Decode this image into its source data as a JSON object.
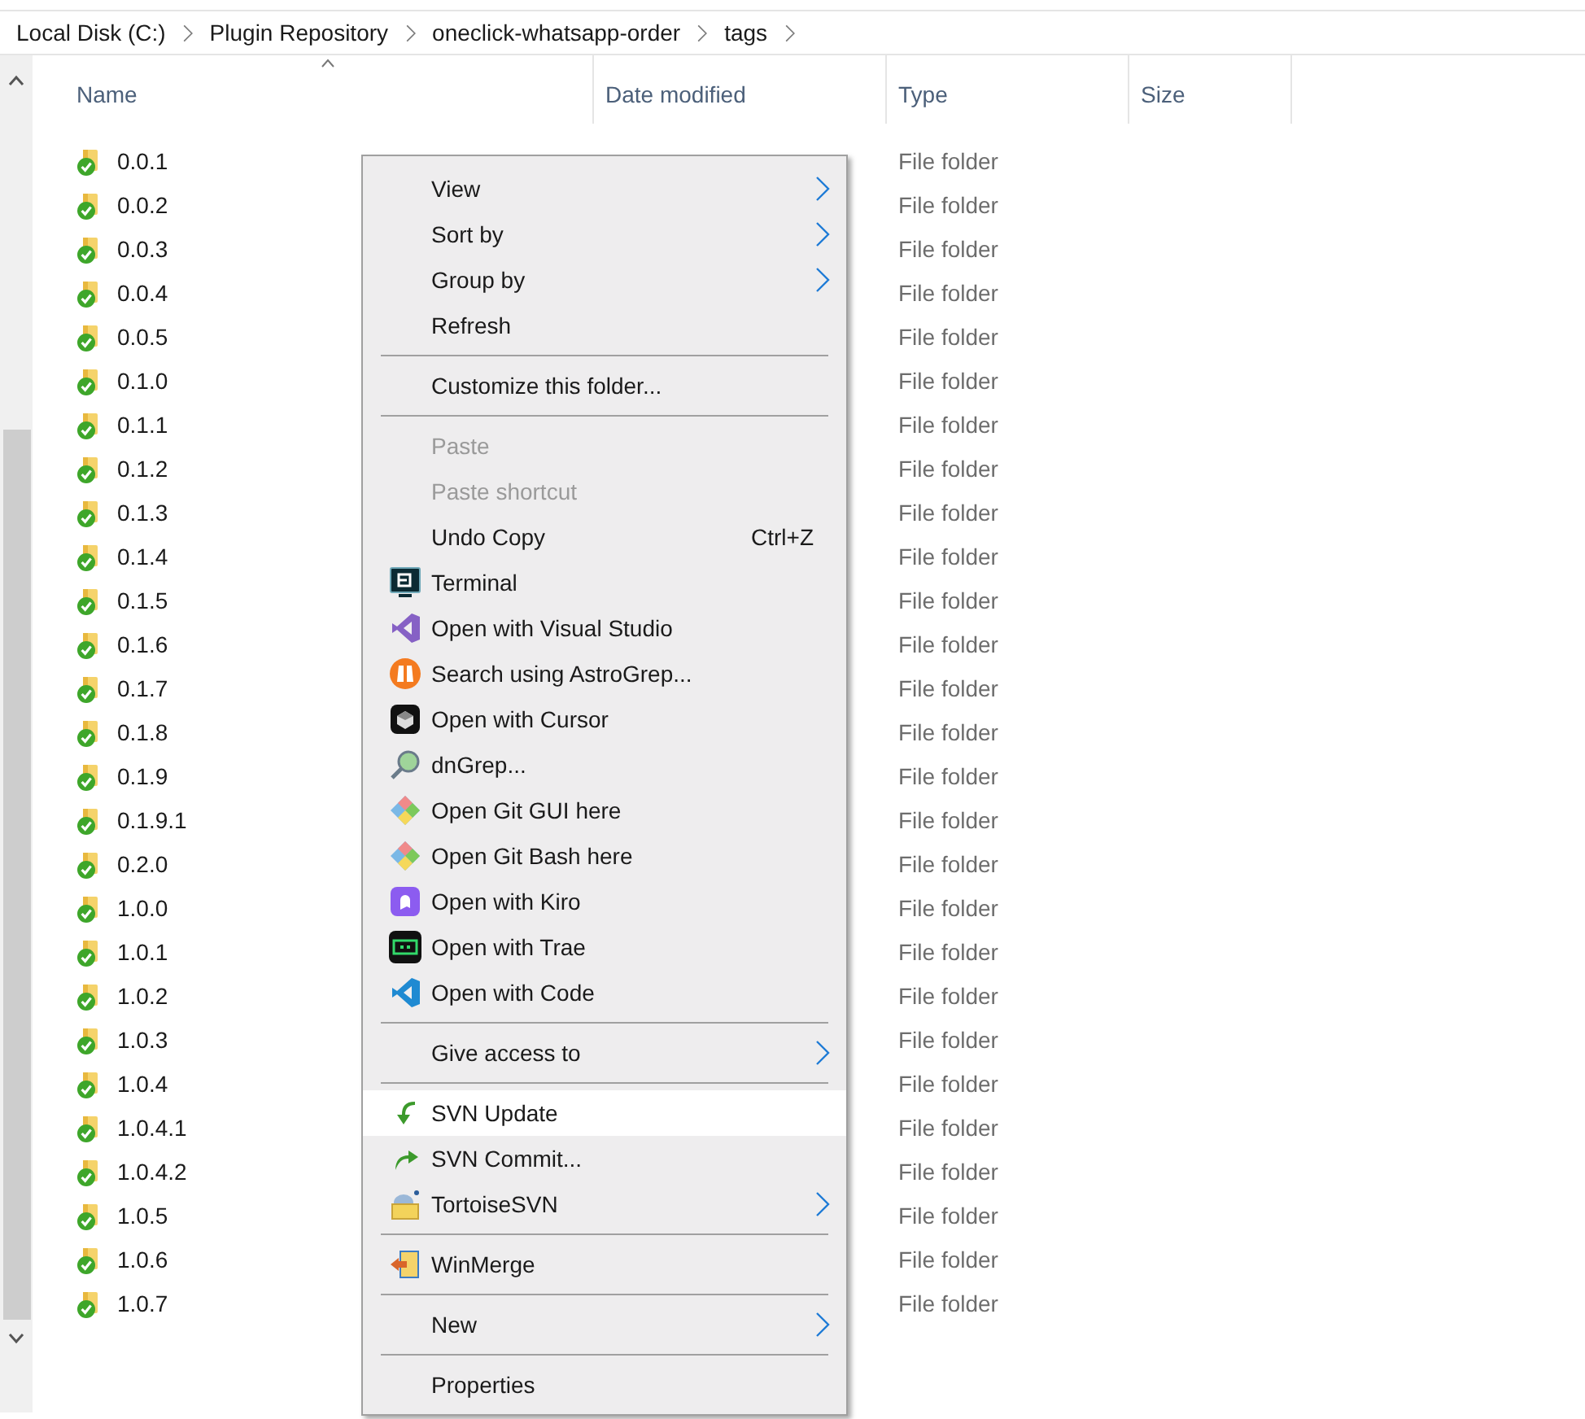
{
  "breadcrumb": [
    "Local Disk (C:)",
    "Plugin Repository",
    "oneclick-whatsapp-order",
    "tags"
  ],
  "columns": [
    {
      "label": "Name",
      "sorted": true
    },
    {
      "label": "Date modified",
      "sorted": false
    },
    {
      "label": "Type",
      "sorted": false
    },
    {
      "label": "Size",
      "sorted": false
    }
  ],
  "rows": [
    {
      "name": "0.0.1",
      "type": "File folder"
    },
    {
      "name": "0.0.2",
      "type": "File folder"
    },
    {
      "name": "0.0.3",
      "type": "File folder"
    },
    {
      "name": "0.0.4",
      "type": "File folder"
    },
    {
      "name": "0.0.5",
      "type": "File folder"
    },
    {
      "name": "0.1.0",
      "type": "File folder"
    },
    {
      "name": "0.1.1",
      "type": "File folder"
    },
    {
      "name": "0.1.2",
      "type": "File folder"
    },
    {
      "name": "0.1.3",
      "type": "File folder"
    },
    {
      "name": "0.1.4",
      "type": "File folder"
    },
    {
      "name": "0.1.5",
      "type": "File folder"
    },
    {
      "name": "0.1.6",
      "type": "File folder"
    },
    {
      "name": "0.1.7",
      "type": "File folder"
    },
    {
      "name": "0.1.8",
      "type": "File folder"
    },
    {
      "name": "0.1.9",
      "type": "File folder"
    },
    {
      "name": "0.1.9.1",
      "type": "File folder"
    },
    {
      "name": "0.2.0",
      "type": "File folder"
    },
    {
      "name": "1.0.0",
      "type": "File folder"
    },
    {
      "name": "1.0.1",
      "type": "File folder"
    },
    {
      "name": "1.0.2",
      "type": "File folder"
    },
    {
      "name": "1.0.3",
      "type": "File folder"
    },
    {
      "name": "1.0.4",
      "type": "File folder"
    },
    {
      "name": "1.0.4.1",
      "type": "File folder"
    },
    {
      "name": "1.0.4.2",
      "type": "File folder"
    },
    {
      "name": "1.0.5",
      "type": "File folder"
    },
    {
      "name": "1.0.6",
      "type": "File folder"
    },
    {
      "name": "1.0.7",
      "type": "File folder"
    }
  ],
  "context_menu": [
    {
      "kind": "item",
      "label": "View",
      "submenu": true,
      "disabled": false,
      "selected": false
    },
    {
      "kind": "item",
      "label": "Sort by",
      "submenu": true,
      "disabled": false,
      "selected": false
    },
    {
      "kind": "item",
      "label": "Group by",
      "submenu": true,
      "disabled": false,
      "selected": false
    },
    {
      "kind": "item",
      "label": "Refresh",
      "submenu": false,
      "disabled": false,
      "selected": false
    },
    {
      "kind": "separator"
    },
    {
      "kind": "item",
      "label": "Customize this folder...",
      "submenu": false,
      "disabled": false,
      "selected": false
    },
    {
      "kind": "separator"
    },
    {
      "kind": "item",
      "label": "Paste",
      "submenu": false,
      "disabled": true,
      "selected": false
    },
    {
      "kind": "item",
      "label": "Paste shortcut",
      "submenu": false,
      "disabled": true,
      "selected": false
    },
    {
      "kind": "item",
      "label": "Undo Copy",
      "shortcut": "Ctrl+Z",
      "submenu": false,
      "disabled": false,
      "selected": false
    },
    {
      "kind": "item",
      "label": "Terminal",
      "submenu": false,
      "disabled": false,
      "selected": false
    },
    {
      "kind": "item",
      "label": "Open with Visual Studio",
      "submenu": false,
      "disabled": false,
      "selected": false
    },
    {
      "kind": "item",
      "label": "Search using AstroGrep...",
      "submenu": false,
      "disabled": false,
      "selected": false
    },
    {
      "kind": "item",
      "label": "Open with Cursor",
      "submenu": false,
      "disabled": false,
      "selected": false
    },
    {
      "kind": "item",
      "label": "dnGrep...",
      "submenu": false,
      "disabled": false,
      "selected": false
    },
    {
      "kind": "item",
      "label": "Open Git GUI here",
      "submenu": false,
      "disabled": false,
      "selected": false
    },
    {
      "kind": "item",
      "label": "Open Git Bash here",
      "submenu": false,
      "disabled": false,
      "selected": false
    },
    {
      "kind": "item",
      "label": "Open with Kiro",
      "submenu": false,
      "disabled": false,
      "selected": false
    },
    {
      "kind": "item",
      "label": "Open with Trae",
      "submenu": false,
      "disabled": false,
      "selected": false
    },
    {
      "kind": "item",
      "label": "Open with Code",
      "submenu": false,
      "disabled": false,
      "selected": false
    },
    {
      "kind": "separator"
    },
    {
      "kind": "item",
      "label": "Give access to",
      "submenu": true,
      "disabled": false,
      "selected": false
    },
    {
      "kind": "separator"
    },
    {
      "kind": "item",
      "label": "SVN Update",
      "submenu": false,
      "disabled": false,
      "selected": true
    },
    {
      "kind": "item",
      "label": "SVN Commit...",
      "submenu": false,
      "disabled": false,
      "selected": false
    },
    {
      "kind": "item",
      "label": "TortoiseSVN",
      "submenu": true,
      "disabled": false,
      "selected": false
    },
    {
      "kind": "separator"
    },
    {
      "kind": "item",
      "label": "WinMerge",
      "submenu": false,
      "disabled": false,
      "selected": false
    },
    {
      "kind": "separator"
    },
    {
      "kind": "item",
      "label": "New",
      "submenu": true,
      "disabled": false,
      "selected": false
    },
    {
      "kind": "separator"
    },
    {
      "kind": "item",
      "label": "Properties",
      "submenu": false,
      "disabled": false,
      "selected": false
    }
  ]
}
